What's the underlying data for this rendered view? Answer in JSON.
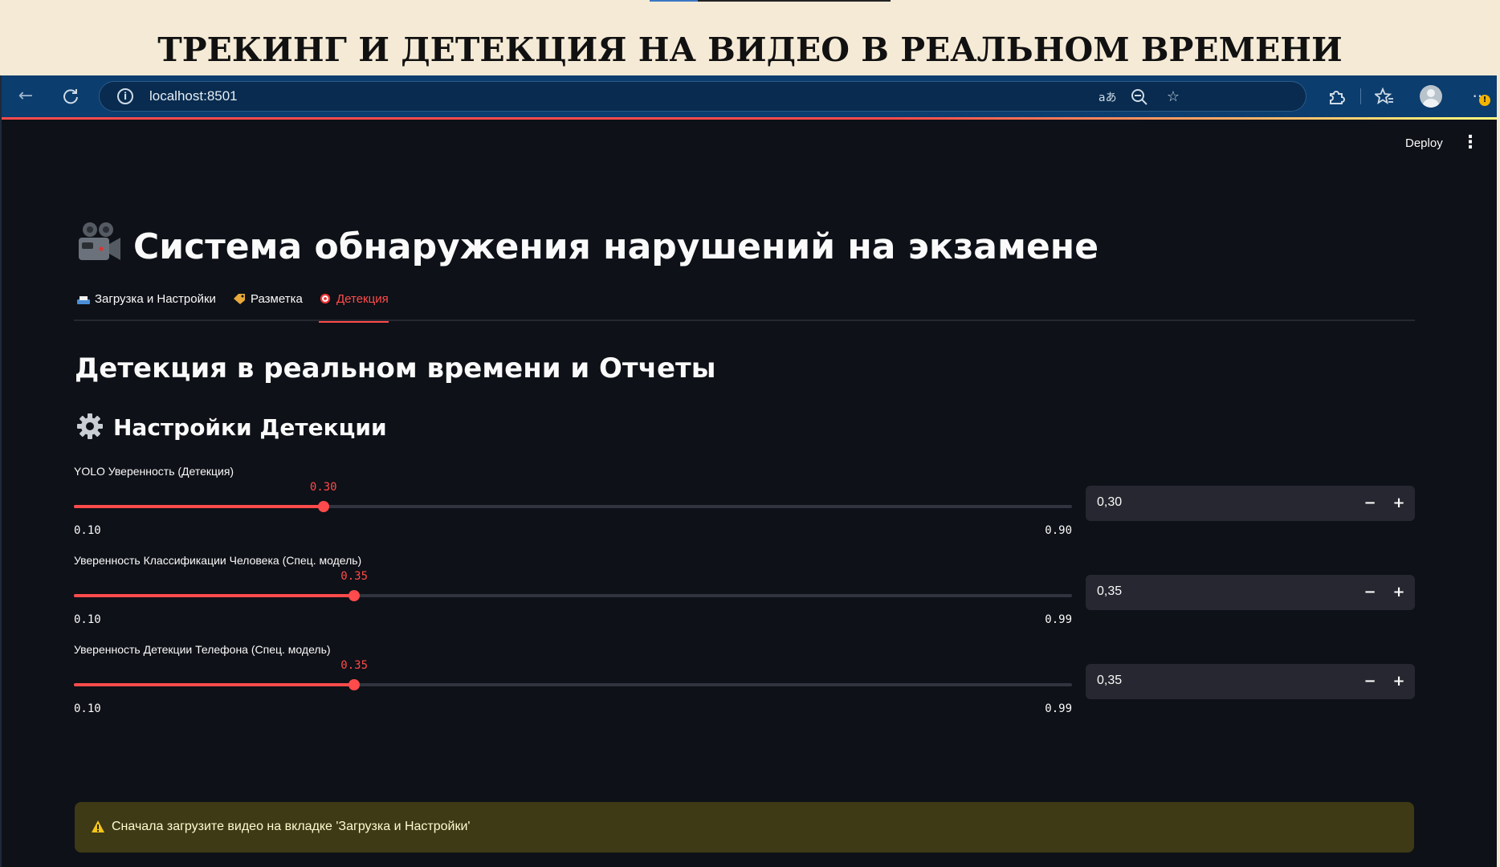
{
  "slide": {
    "title": "ТРЕКИНГ И ДЕТЕКЦИЯ НА ВИДЕО В РЕАЛЬНОМ ВРЕМЕНИ"
  },
  "browser": {
    "url": "localhost:8501",
    "icons": [
      "back-arrow-icon",
      "reload-icon",
      "info-icon",
      "translate-icon",
      "zoom-out-icon",
      "star-icon",
      "extensions-icon",
      "favorites-icon",
      "profile-icon",
      "more-icon"
    ],
    "accent": "#0b3d6e"
  },
  "app": {
    "deploy_label": "Deploy",
    "title": "Система обнаружения нарушений на экзамене",
    "tabs": [
      {
        "label": "Загрузка и Настройки",
        "icon": "upload-tray-icon",
        "active": false
      },
      {
        "label": "Разметка",
        "icon": "tag-icon",
        "active": false
      },
      {
        "label": "Детекция",
        "icon": "target-icon",
        "active": true
      }
    ],
    "section_title": "Детекция в реальном времени и Отчеты",
    "settings_title": "Настройки Детекции",
    "sliders": [
      {
        "label": "YOLO Уверенность (Детекция)",
        "value": 0.3,
        "value_text": "0.30",
        "min": 0.1,
        "max": 0.9,
        "min_text": "0.10",
        "max_text": "0.90",
        "input_text": "0,30"
      },
      {
        "label": "Уверенность Классификации Человека (Спец. модель)",
        "value": 0.35,
        "value_text": "0.35",
        "min": 0.1,
        "max": 0.99,
        "min_text": "0.10",
        "max_text": "0.99",
        "input_text": "0,35"
      },
      {
        "label": "Уверенность Детекции Телефона (Спец. модель)",
        "value": 0.35,
        "value_text": "0.35",
        "min": 0.1,
        "max": 0.99,
        "min_text": "0.10",
        "max_text": "0.99",
        "input_text": "0,35"
      }
    ],
    "stepper": {
      "minus": "−",
      "plus": "+"
    },
    "warning": "Сначала загрузите видео на вкладке 'Загрузка и Настройки'",
    "colors": {
      "background": "#0e1117",
      "accent": "#ff4b4b",
      "warning_bg": "#3e3a16"
    }
  }
}
